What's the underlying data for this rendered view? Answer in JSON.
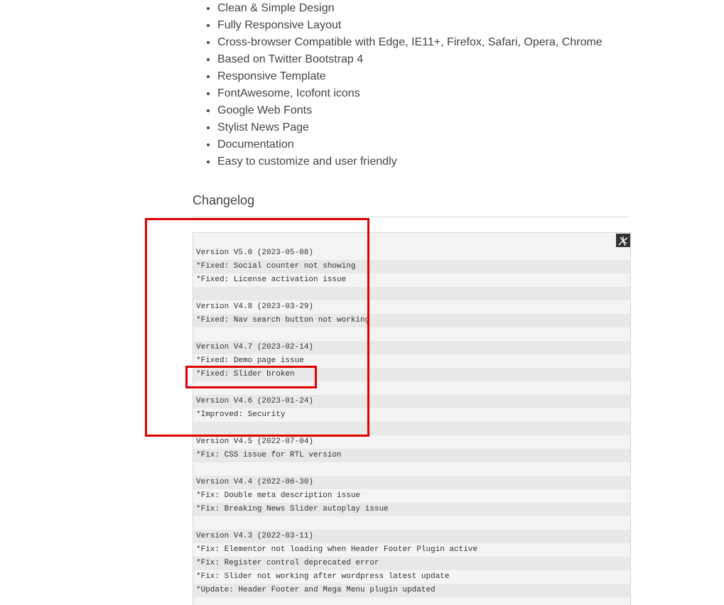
{
  "features": [
    "Clean & Simple Design",
    "Fully Responsive Layout",
    "Cross-browser Compatible with Edge, IE11+, Firefox, Safari, Opera, Chrome",
    "Based on Twitter Bootstrap 4",
    "Responsive Template",
    "FontAwesome, Icofont icons",
    "Google Web Fonts",
    "Stylist News Page",
    "Documentation",
    "Easy to customize and user friendly"
  ],
  "changelog": {
    "title": "Changelog",
    "toggle_icon": "expand-code-icon",
    "lines": [
      "Version V5.0 (2023-05-08)",
      "*Fixed: Social counter not showing",
      "*Fixed: License activation issue",
      "",
      "Version V4.8 (2023-03-29)",
      "*Fixed: Nav search button not working",
      "",
      "Version V4.7 (2023-02-14)",
      "*Fixed: Demo page issue",
      "*Fixed: Slider broken",
      "",
      "Version V4.6 (2023-01-24)",
      "*Improved: Security",
      "",
      "Version V4.5 (2022-07-04)",
      "*Fix: CSS issue for RTL version",
      "",
      "Version V4.4 (2022-06-30)",
      "*Fix: Double meta description issue",
      "*Fix: Breaking News Slider autoplay issue",
      "",
      "Version V4.3 (2022-03-11)",
      "*Fix: Elementor not loading when Header Footer Plugin active",
      "*Fix: Register control deprecated error",
      "*Fix: Slider not working after wordpress latest update",
      "*Update: Header Footer and Mega Menu plugin updated",
      ""
    ]
  },
  "colors": {
    "annotation": "#e00000",
    "text": "#444444",
    "code_bg_light": "#f4f4f4",
    "code_bg_dark": "#e8e8e8"
  }
}
